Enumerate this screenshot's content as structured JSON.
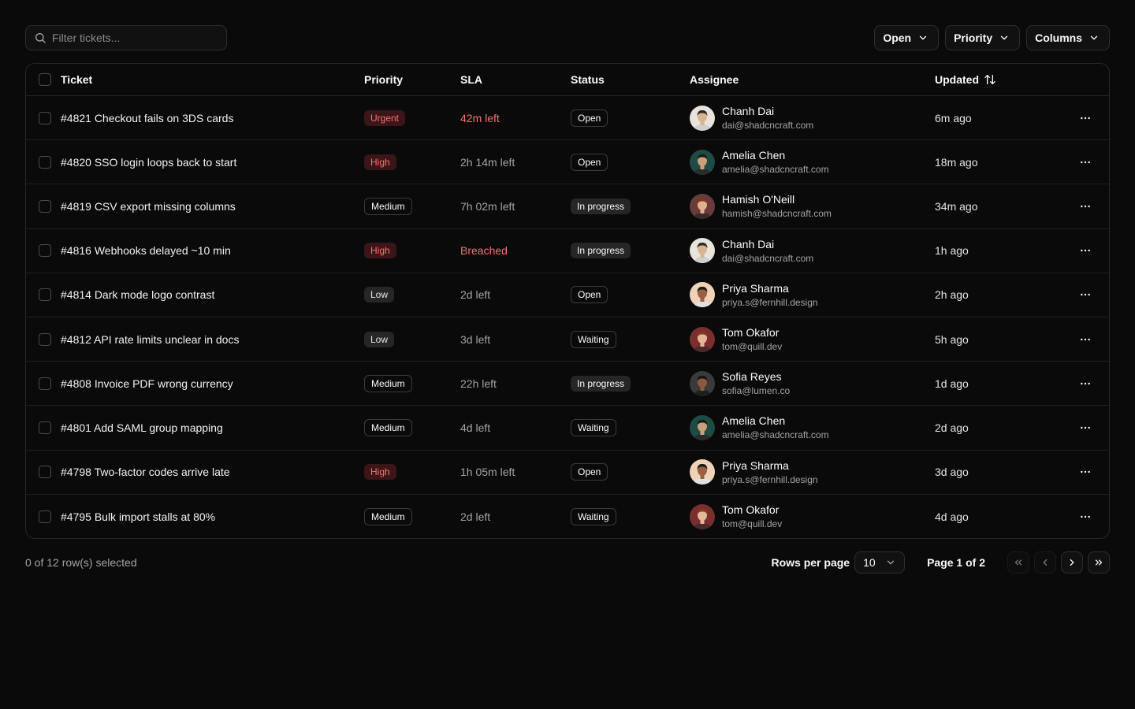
{
  "toolbar": {
    "search_placeholder": "Filter tickets...",
    "filters": [
      {
        "label": "Open"
      },
      {
        "label": "Priority"
      },
      {
        "label": "Columns"
      }
    ]
  },
  "table": {
    "columns": {
      "ticket": "Ticket",
      "priority": "Priority",
      "sla": "SLA",
      "status": "Status",
      "assignee": "Assignee",
      "updated": "Updated"
    },
    "rows": [
      {
        "ticket": "#4821 Checkout fails on 3DS cards",
        "priority": "Urgent",
        "sla": "42m left",
        "sla_danger": true,
        "status": "Open",
        "name": "Chanh Dai",
        "email": "dai@shadcncraft.com",
        "updated": "6m ago",
        "avatar": "light"
      },
      {
        "ticket": "#4820 SSO login loops back to start",
        "priority": "High",
        "sla": "2h 14m left",
        "sla_danger": false,
        "status": "Open",
        "name": "Amelia Chen",
        "email": "amelia@shadcncraft.com",
        "updated": "18m ago",
        "avatar": "teal"
      },
      {
        "ticket": "#4819 CSV export missing columns",
        "priority": "Medium",
        "sla": "7h 02m left",
        "sla_danger": false,
        "status": "In progress",
        "name": "Hamish O'Neill",
        "email": "hamish@shadcncraft.com",
        "updated": "34m ago",
        "avatar": "rose"
      },
      {
        "ticket": "#4816 Webhooks delayed ~10 min",
        "priority": "High",
        "sla": "Breached",
        "sla_danger": true,
        "status": "In progress",
        "name": "Chanh Dai",
        "email": "dai@shadcncraft.com",
        "updated": "1h ago",
        "avatar": "light"
      },
      {
        "ticket": "#4814 Dark mode logo contrast",
        "priority": "Low",
        "sla": "2d left",
        "sla_danger": false,
        "status": "Open",
        "name": "Priya Sharma",
        "email": "priya.s@fernhill.design",
        "updated": "2h ago",
        "avatar": "peach"
      },
      {
        "ticket": "#4812 API rate limits unclear in docs",
        "priority": "Low",
        "sla": "3d left",
        "sla_danger": false,
        "status": "Waiting",
        "name": "Tom Okafor",
        "email": "tom@quill.dev",
        "updated": "5h ago",
        "avatar": "red"
      },
      {
        "ticket": "#4808 Invoice PDF wrong currency",
        "priority": "Medium",
        "sla": "22h left",
        "sla_danger": false,
        "status": "In progress",
        "name": "Sofia Reyes",
        "email": "sofia@lumen.co",
        "updated": "1d ago",
        "avatar": "dark"
      },
      {
        "ticket": "#4801 Add SAML group mapping",
        "priority": "Medium",
        "sla": "4d left",
        "sla_danger": false,
        "status": "Waiting",
        "name": "Amelia Chen",
        "email": "amelia@shadcncraft.com",
        "updated": "2d ago",
        "avatar": "teal"
      },
      {
        "ticket": "#4798 Two-factor codes arrive late",
        "priority": "High",
        "sla": "1h 05m left",
        "sla_danger": false,
        "status": "Open",
        "name": "Priya Sharma",
        "email": "priya.s@fernhill.design",
        "updated": "3d ago",
        "avatar": "peach"
      },
      {
        "ticket": "#4795 Bulk import stalls at 80%",
        "priority": "Medium",
        "sla": "2d left",
        "sla_danger": false,
        "status": "Waiting",
        "name": "Tom Okafor",
        "email": "tom@quill.dev",
        "updated": "4d ago",
        "avatar": "red"
      }
    ]
  },
  "footer": {
    "selected_text": "0 of 12 row(s) selected",
    "rows_per_page_label": "Rows per page",
    "rows_per_page_value": "10",
    "page_info": "Page 1 of 2"
  },
  "colors": {
    "background": "#0a0a0a",
    "danger": "#f87171",
    "danger_bg": "#3b1517",
    "border": "#262626",
    "muted_text": "#a3a3a3"
  },
  "icons": {
    "search": "search-icon",
    "chevron": "chevron-down-icon",
    "sort": "arrow-up-down-icon",
    "more": "more-horizontal-icon",
    "first": "chevrons-left-icon",
    "prev": "chevron-left-icon",
    "next": "chevron-right-icon",
    "last": "chevrons-right-icon"
  }
}
